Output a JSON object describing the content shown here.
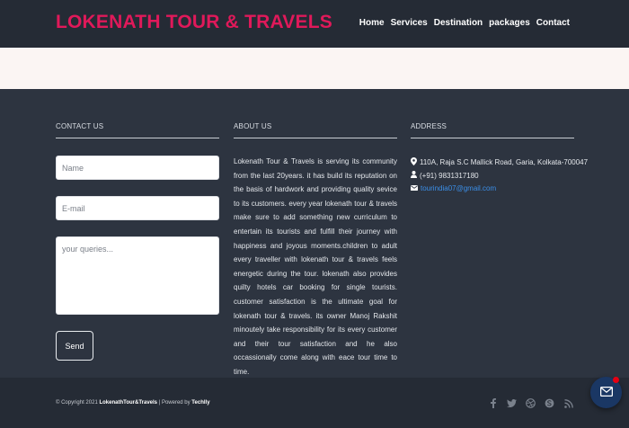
{
  "brand": {
    "name": "LOKENATH TOUR & TRAVELS",
    "color": "#e0195a"
  },
  "nav": {
    "items": [
      {
        "label": "Home"
      },
      {
        "label": "Services"
      },
      {
        "label": "Destination"
      },
      {
        "label": "packages"
      },
      {
        "label": "Contact"
      }
    ]
  },
  "contact": {
    "title": "CONTACT US",
    "name_placeholder": "Name",
    "email_placeholder": "E-mail",
    "query_placeholder": "your queries...",
    "send_label": "Send"
  },
  "about": {
    "title": "ABOUT US",
    "text": "Lokenath Tour & Travels is serving its community from the last 20years. it has build its reputation on the basis of hardwork and providing quality sevice to its customers. every year lokenath tour & travels make sure to add something new curriculum to entertain its tourists and fulfill their journey with happiness and joyous moments.children to adult every traveller with lokenath tour & travels feels energetic during the tour. lokenath also provides quilty hotels car booking for single tourists. customer satisfaction is the ultimate goal for lokenath tour & travels. its owner Manoj Rakshit minoutely take responsibility for its every customer and their tour satisfaction and he also occassionally come along with eace tour time to time."
  },
  "address": {
    "title": "ADDRESS",
    "street": "110A, Raja S.C Mallick Road, Garia, Kolkata-700047",
    "phone": "(+91) 9831317180",
    "email": "tourindia07@gmail.com",
    "link_color": "#3b8fe8"
  },
  "footer": {
    "copyright_prefix": "© Copyright 2021",
    "company": "LokenathTour&Travels",
    "separator": "|",
    "powered_by": "Powered by",
    "powered_company": "Techlly",
    "social_icons": [
      "facebook-icon",
      "twitter-icon",
      "dribbble-icon",
      "skype-icon",
      "rss-icon"
    ]
  },
  "chat": {
    "icon": "mail-icon",
    "badge_color": "#e60012"
  }
}
